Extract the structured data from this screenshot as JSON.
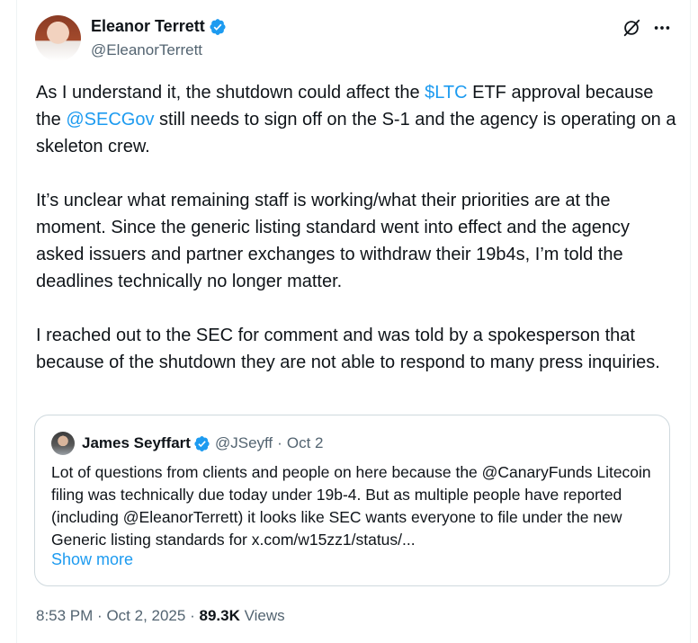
{
  "author": {
    "display_name": "Eleanor Terrett",
    "handle": "@EleanorTerrett"
  },
  "icons": {
    "verified": "verified-badge-icon",
    "grok": "grok-icon",
    "more": "more-icon"
  },
  "colors": {
    "link": "#1d9bf0",
    "verified": "#1d9bf0",
    "secondary_text": "#536471"
  },
  "tweet": {
    "p1": {
      "t1": "As I understand it, the shutdown could affect the ",
      "cashtag": "$LTC",
      "t2": " ETF approval because the ",
      "mention": "@SECGov",
      "t3": " still needs to sign off on the S-1 and the agency is operating on a skeleton crew."
    },
    "p2": "It’s unclear what remaining staff is working/what their priorities are at the moment. Since the generic listing standard went into effect and the agency asked issuers and partner exchanges to withdraw their 19b4s, I’m told the deadlines technically no longer matter.",
    "p3": "I reached out to the SEC for comment and was told by a spokesperson that because of the shutdown they are not able to respond to many press inquiries."
  },
  "quote": {
    "display_name": "James Seyffart",
    "handle": "@JSeyff",
    "separator": "·",
    "date": "Oct 2",
    "text": "Lot of questions from clients and people on here because the @CanaryFunds Litecoin filing was technically due today under 19b-4. But as multiple people have reported  (including @EleanorTerrett) it looks like SEC wants everyone to file under the new Generic listing standards for x.com/w15zz1/status/...",
    "show_more": "Show more"
  },
  "footer": {
    "time": "8:53 PM",
    "sep1": "·",
    "date": "Oct 2, 2025",
    "sep2": "·",
    "views_count": "89.3K",
    "views_label": "Views"
  }
}
